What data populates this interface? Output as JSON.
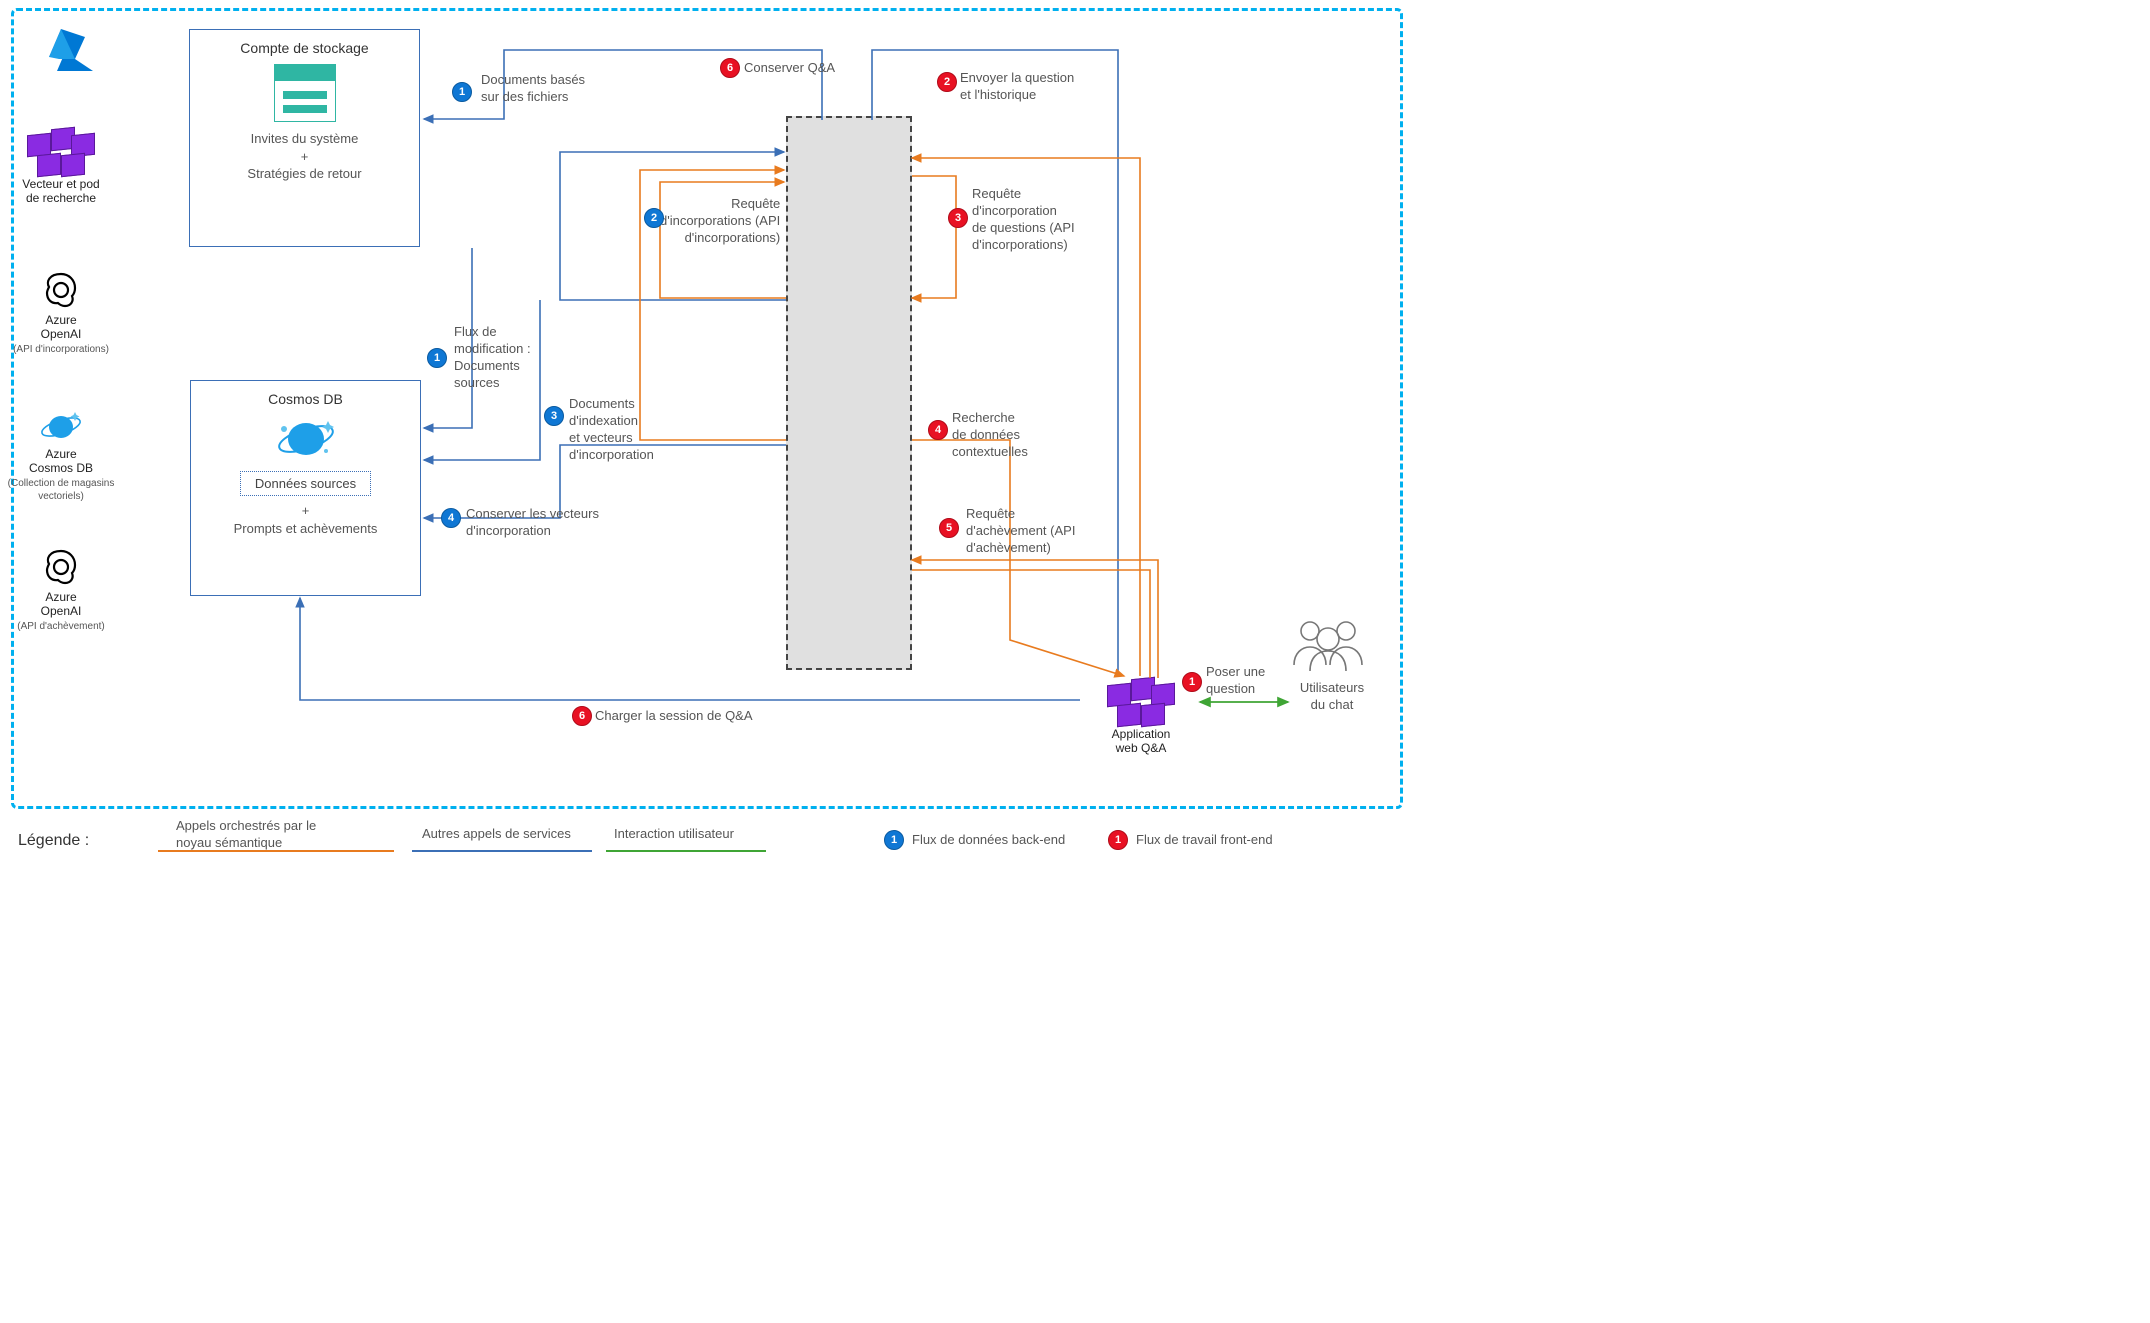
{
  "boxes": {
    "storage": {
      "title": "Compte de stockage",
      "sub1": "Invites du système",
      "plus": "+",
      "sub2": "Stratégies de retour"
    },
    "cosmos": {
      "title": "Cosmos DB",
      "inner": "Données sources",
      "plus": "+",
      "sub2": "Prompts et achèvements"
    }
  },
  "services": {
    "vector": {
      "line1": "Vecteur et pod",
      "line2": "de recherche"
    },
    "openai_embed": {
      "line1": "Azure",
      "line2": "OpenAI",
      "sub": "(API d'incorporations)"
    },
    "cosmos_vec": {
      "line1": "Azure",
      "line2": "Cosmos DB",
      "sub": "(Collection de magasins vectoriels)"
    },
    "openai_comp": {
      "line1": "Azure",
      "line2": "OpenAI",
      "sub": "(API d'achèvement)"
    },
    "webapp": {
      "line1": "Application",
      "line2": "web Q&A"
    }
  },
  "users": {
    "line1": "Utilisateurs",
    "line2": "du chat"
  },
  "labels": {
    "docs_files": "Documents basés\nsur des fichiers",
    "conserver_qa": "Conserver Q&A",
    "envoyer_q": "Envoyer la question\net l'historique",
    "req_incorp_api": "Requête\nd'incorporations (API\nd'incorporations)",
    "req_incorp_q": "Requête\nd'incorporation\nde questions (API\nd'incorporations)",
    "flux_modif": "Flux de\nmodification :\nDocuments\nsources",
    "docs_index": "Documents\nd'indexation\net vecteurs\nd'incorporation",
    "recherche_ctx": "Recherche\nde données\ncontextuelles",
    "conserver_vec": "Conserver les vecteurs\nd'incorporation",
    "req_achev": "Requête\nd'achèvement (API\nd'achèvement)",
    "charger_session": "Charger la session de Q&A",
    "poser_q": "Poser une\nquestion"
  },
  "steps": {
    "blue": {
      "1a": "1",
      "1b": "1",
      "2": "2",
      "3": "3",
      "4": "4"
    },
    "red": {
      "1": "1",
      "2": "2",
      "3": "3",
      "4": "4",
      "5": "5",
      "6a": "6",
      "6b": "6"
    }
  },
  "legend": {
    "title": "Légende :",
    "orange": "Appels orchestrés par le\nnoyau sémantique",
    "blue": "Autres appels de services",
    "green": "Interaction utilisateur",
    "backend": "Flux de données back-end",
    "frontend": "Flux de travail front-end"
  }
}
